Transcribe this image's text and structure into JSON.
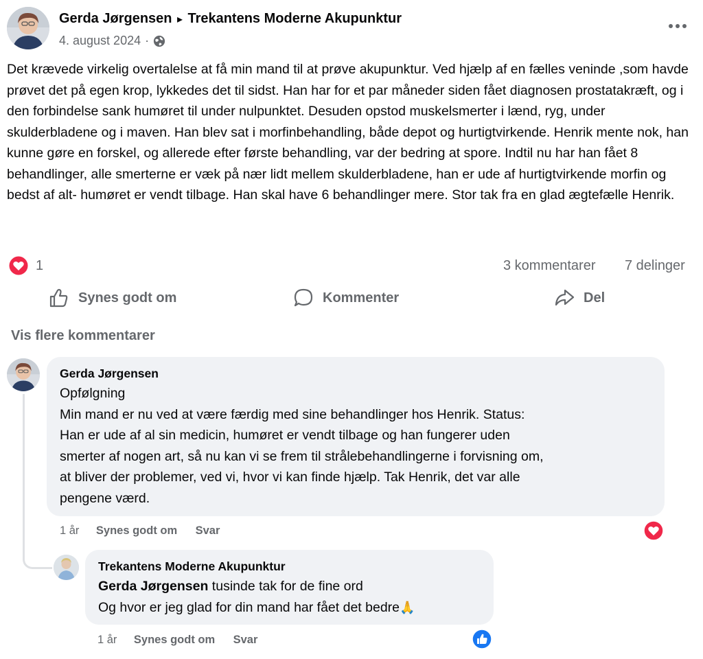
{
  "post": {
    "author": "Gerda Jørgensen",
    "arrow": "▸",
    "page": "Trekantens Moderne Akupunktur",
    "date": "4. august 2024",
    "separator": "·",
    "audience_icon": "globe-icon",
    "more_icon": "more-icon",
    "text": "Det krævede virkelig overtalelse at få min mand til at prøve akupunktur. Ved hjælp af en fælles veninde ,som havde prøvet det på egen krop, lykkedes det til sidst. Han har for et par måneder siden fået diagnosen prostatakræft, og i den forbindelse sank humøret til under nulpunktet. Desuden opstod muskelsmerter i lænd, ryg, under skulderbladene og i maven. Han blev sat i morfinbehandling, både depot og hurtigtvirkende. Henrik mente nok, han kunne gøre en forskel, og allerede efter første behandling, var der bedring at spore. Indtil nu har han fået 8 behandlinger, alle smerterne er væk på nær lidt mellem skulderbladene, han er ude af hurtigtvirkende morfin og bedst af alt- humøret er vendt tilbage. Han skal have 6 behandlinger mere. Stor tak fra en glad ægtefælle Henrik.",
    "reaction_count": "1",
    "comments_count": "3 kommentarer",
    "shares_count": "7 delinger"
  },
  "actions": {
    "like": "Synes godt om",
    "comment": "Kommenter",
    "share": "Del"
  },
  "more_comments": "Vis flere kommentarer",
  "comments": [
    {
      "author": "Gerda Jørgensen",
      "lines": [
        "Opfølgning",
        "Min mand er nu ved at være færdig med sine behandlinger hos Henrik. Status:",
        "Han er ude af al sin medicin, humøret er vendt tilbage og han fungerer uden",
        "smerter af nogen art, så nu kan vi se frem til strålebehandlingerne i forvisning om,",
        "at bliver der problemer, ved vi, hvor vi kan finde hjælp. Tak Henrik, det var alle",
        "pengene værd."
      ],
      "time": "1 år",
      "like": "Synes godt om",
      "reply": "Svar",
      "reaction_icon": "heart-icon"
    },
    {
      "author": "Trekantens Moderne Akupunktur",
      "mention": "Gerda Jørgensen",
      "text1": " tusinde tak for de fine ord",
      "text2": "Og hvor er jeg glad for din mand har fået det bedre",
      "emoji": "🙏",
      "time": "1 år",
      "like": "Synes godt om",
      "reply": "Svar",
      "reaction_icon": "thumbs-up-icon"
    }
  ],
  "colors": {
    "heart": "#f0284a",
    "like": "#1877f2",
    "muted": "#65686c",
    "bubble": "#f0f2f5"
  }
}
